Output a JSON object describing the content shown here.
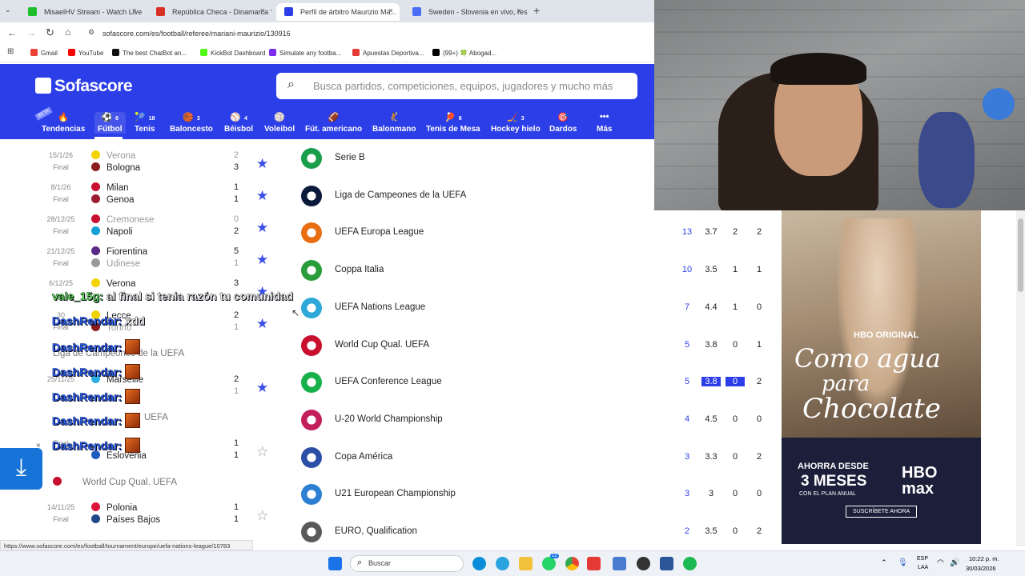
{
  "browser": {
    "tabs": [
      {
        "label": "MisaelHV Stream - Watch Live o",
        "color": "#1fbf2c"
      },
      {
        "label": "República Checa - Dinamarca ?",
        "color": "#d93025"
      },
      {
        "label": "Perfil de árbitro Maurizio Ma...",
        "color": "#2c3ee8"
      },
      {
        "label": "Sweden - Slovenia en vivo, res...",
        "color": "#4a6cf7"
      }
    ],
    "new_tab": "+",
    "close": "×",
    "url": "sofascore.com/es/football/referee/mariani-maurizio/130916",
    "bookmarks": [
      {
        "label": "Gmail",
        "color": "#ea4335"
      },
      {
        "label": "YouTube",
        "color": "#ff0000"
      },
      {
        "label": "The best ChatBot an...",
        "color": "#111111"
      },
      {
        "label": "KickBot Dashboard",
        "color": "#53fc18"
      },
      {
        "label": "Simulate any footba...",
        "color": "#7a2cf0"
      },
      {
        "label": "Apuestas Deportiva...",
        "color": "#e53935"
      },
      {
        "label": "(99+) 🍀 Abogad...",
        "color": "#000000"
      }
    ]
  },
  "site": {
    "logo": "Sofascore",
    "search_placeholder": "Busca partidos, competiciones, equipos, jugadores y mucho más",
    "nav": [
      {
        "label": "Tendencias",
        "count": "",
        "icon": "flame-icon",
        "glyph": "🔥"
      },
      {
        "label": "Fútbol",
        "count": "6",
        "icon": "football-icon",
        "glyph": "⚽"
      },
      {
        "label": "Tenis",
        "count": "18",
        "icon": "tennis-icon",
        "glyph": "🎾"
      },
      {
        "label": "Baloncesto",
        "count": "3",
        "icon": "basketball-icon",
        "glyph": "🏀"
      },
      {
        "label": "Béisbol",
        "count": "4",
        "icon": "baseball-icon",
        "glyph": "⚾"
      },
      {
        "label": "Voleibol",
        "count": "",
        "icon": "volleyball-icon",
        "glyph": "🏐"
      },
      {
        "label": "Fút. americano",
        "count": "",
        "icon": "american-football-icon",
        "glyph": "🏈"
      },
      {
        "label": "Balonmano",
        "count": "",
        "icon": "handball-icon",
        "glyph": "🤾"
      },
      {
        "label": "Tenis de Mesa",
        "count": "6",
        "icon": "table-tennis-icon",
        "glyph": "🏓"
      },
      {
        "label": "Hockey hielo",
        "count": "3",
        "icon": "ice-hockey-icon",
        "glyph": "🏒"
      },
      {
        "label": "Dardos",
        "count": "",
        "icon": "darts-icon",
        "glyph": "🎯"
      },
      {
        "label": "Más",
        "count": "",
        "icon": "more-icon",
        "glyph": "•••"
      }
    ],
    "beta": "BETA"
  },
  "matches": [
    {
      "date": "15/1/26",
      "status": "Final",
      "home": "Verona",
      "away": "Bologna",
      "hs": "2",
      "as": "3",
      "winner": "away",
      "fav": true,
      "hc": "#f2d200",
      "ac": "#8a1c1c"
    },
    {
      "date": "8/1/26",
      "status": "Final",
      "home": "Milan",
      "away": "Genoa",
      "hs": "1",
      "as": "1",
      "winner": "none",
      "fav": true,
      "hc": "#c8102e",
      "ac": "#9b1b30"
    },
    {
      "date": "28/12/25",
      "status": "Final",
      "home": "Cremonese",
      "away": "Napoli",
      "hs": "0",
      "as": "2",
      "winner": "away",
      "fav": true,
      "hc": "#c8102e",
      "ac": "#12a0d7"
    },
    {
      "date": "21/12/25",
      "status": "Final",
      "home": "Fiorentina",
      "away": "Udinese",
      "hs": "5",
      "as": "1",
      "winner": "home",
      "fav": true,
      "hc": "#5b2a86",
      "ac": "#999999"
    },
    {
      "date": "6/12/25",
      "status": "",
      "home": "Verona",
      "away": "",
      "hs": "3",
      "as": "",
      "winner": "home",
      "fav": true,
      "hc": "#f2d200",
      "ac": "#ffffff"
    },
    {
      "date": "30",
      "status": "Final",
      "home": "Lecce",
      "away": "Torino",
      "hs": "2",
      "as": "1",
      "winner": "home",
      "fav": true,
      "hc": "#f2d200",
      "ac": "#8a1c1c"
    },
    {
      "date": "25/11/25",
      "status": "",
      "home": "Marseille",
      "away": "",
      "hs": "2",
      "as": "1",
      "winner": "home",
      "fav": true,
      "hc": "#2faee0",
      "ac": "#ffffff"
    },
    {
      "date": "",
      "status": "Final",
      "home": "",
      "away": "Eslovenia",
      "hs": "1",
      "as": "1",
      "winner": "none",
      "fav": false,
      "hc": "#ffffff",
      "ac": "#1d5bbf"
    },
    {
      "date": "14/11/25",
      "status": "Final",
      "home": "Polonia",
      "away": "Países Bajos",
      "hs": "1",
      "as": "1",
      "winner": "none",
      "fav": false,
      "hc": "#dc143c",
      "ac": "#21468b"
    }
  ],
  "groups": [
    {
      "label": "Liga de Campeones de la UEFA"
    },
    {
      "label": "UEFA"
    },
    {
      "label": "World Cup Qual. UEFA"
    }
  ],
  "chat": [
    {
      "user": "vale_15g:",
      "msg": "al final si tenia razón tu comunidad",
      "emote": false,
      "green": true
    },
    {
      "user": "DashRendar:",
      "msg": "xdd",
      "emote": false,
      "green": false
    },
    {
      "user": "DashRendar:",
      "msg": "",
      "emote": true,
      "green": false
    },
    {
      "user": "DashRendar:",
      "msg": "",
      "emote": true,
      "green": false
    },
    {
      "user": "DashRendar:",
      "msg": "",
      "emote": true,
      "green": false
    },
    {
      "user": "DashRendar:",
      "msg": "",
      "emote": true,
      "green": false
    },
    {
      "user": "DashRendar:",
      "msg": "",
      "emote": true,
      "green": false
    }
  ],
  "competitions": [
    {
      "name": "Serie B",
      "games": "",
      "avg": "",
      "red": "",
      "pen": "",
      "color": "#1a9e4b"
    },
    {
      "name": "Liga de Campeones de la UEFA",
      "games": "",
      "avg": "",
      "red": "",
      "pen": "",
      "color": "#0b1a3a"
    },
    {
      "name": "UEFA Europa League",
      "games": "13",
      "avg": "3.7",
      "red": "2",
      "pen": "2",
      "color": "#e86e14"
    },
    {
      "name": "Coppa Italia",
      "games": "10",
      "avg": "3.5",
      "red": "1",
      "pen": "1",
      "color": "#2a9d3b"
    },
    {
      "name": "UEFA Nations League",
      "games": "7",
      "avg": "4.4",
      "red": "1",
      "pen": "0",
      "color": "#2fa7d8"
    },
    {
      "name": "World Cup Qual. UEFA",
      "games": "5",
      "avg": "3.8",
      "red": "0",
      "pen": "1",
      "color": "#c8102e"
    },
    {
      "name": "UEFA Conference League",
      "games": "5",
      "avg": "3.8",
      "red": "0",
      "pen": "2",
      "color": "#18b04a"
    },
    {
      "name": "U-20 World Championship",
      "games": "4",
      "avg": "4.5",
      "red": "0",
      "pen": "0",
      "color": "#c21f5b"
    },
    {
      "name": "Copa América",
      "games": "3",
      "avg": "3.3",
      "red": "0",
      "pen": "2",
      "color": "#2b4fa6"
    },
    {
      "name": "U21 European Championship",
      "games": "3",
      "avg": "3",
      "red": "0",
      "pen": "0",
      "color": "#2d7fd1"
    },
    {
      "name": "EURO, Qualification",
      "games": "2",
      "avg": "3.5",
      "red": "0",
      "pen": "2",
      "color": "#5a5a5a"
    }
  ],
  "ad": {
    "brand_top": "HBO ORIGINAL",
    "title_line1": "Como agua",
    "title_line2": "para",
    "title_line3": "Chocolate",
    "offer_line1": "AHORRA DESDE",
    "offer_line2": "3 MESES",
    "offer_line3": "CON EL PLAN ANUAL",
    "brand": "HBO max",
    "cta": "SUSCRÍBETE AHORA"
  },
  "status_url": "https://www.sofascore.com/es/football/tournament/europe/uefa-nations-league/10783",
  "taskbar": {
    "search": "Buscar",
    "badge": "12",
    "lang_top": "ESP",
    "lang_bottom": "LAA",
    "time": "10:22 p. m.",
    "date": "30/03/2026"
  }
}
